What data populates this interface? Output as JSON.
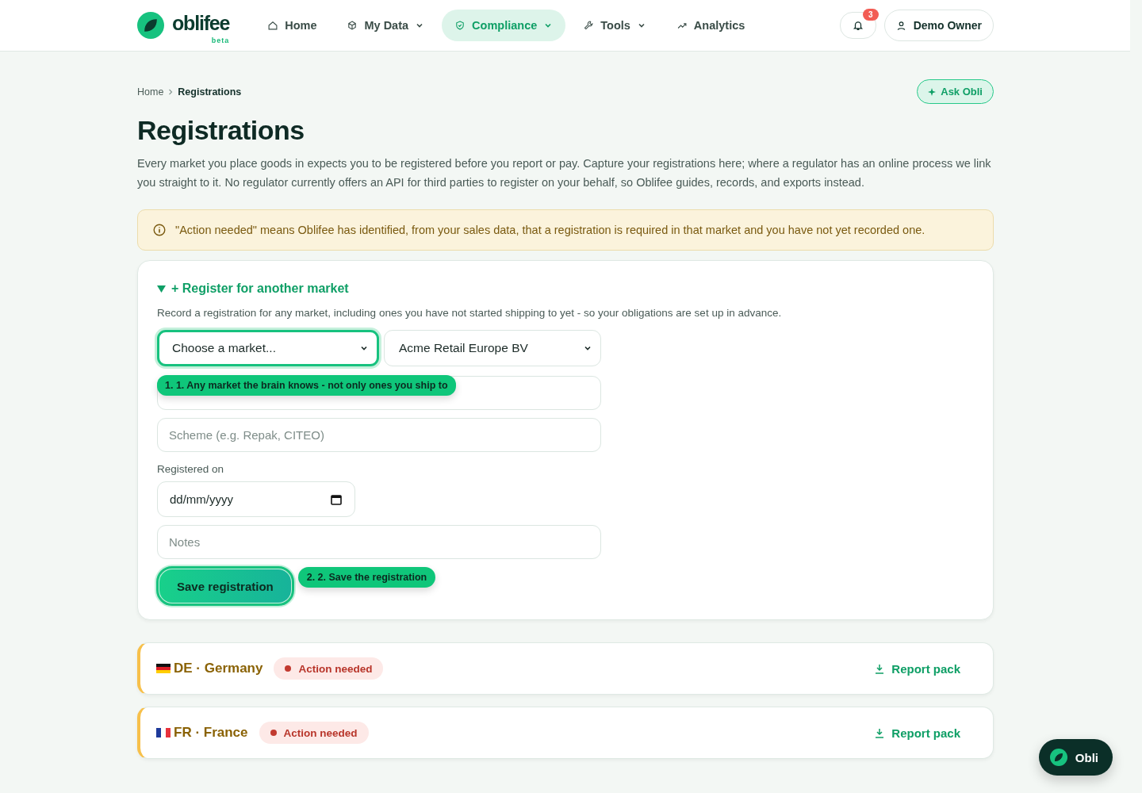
{
  "header": {
    "logo": "oblifee",
    "logo_tag": "beta",
    "nav": [
      {
        "label": "Home",
        "dropdown": false,
        "selected": false
      },
      {
        "label": "My Data",
        "dropdown": true,
        "selected": false
      },
      {
        "label": "Compliance",
        "dropdown": true,
        "selected": true
      },
      {
        "label": "Tools",
        "dropdown": true,
        "selected": false
      },
      {
        "label": "Analytics",
        "dropdown": false,
        "selected": false
      }
    ],
    "notifications": "3",
    "user": "Demo Owner"
  },
  "breadcrumb": [
    {
      "label": "Home",
      "selected": false
    },
    {
      "label": "Registrations",
      "selected": true
    }
  ],
  "ask_button": "Ask Obli",
  "title": "Registrations",
  "intro": "Every market you place goods in expects you to be registered before you report or pay. Capture your registrations here; where a regulator has an online process we link you straight to it. No regulator currently offers an API for third parties to register on your behalf, so Oblifee guides, records, and exports instead.",
  "notice": "\"Action needed\" means Oblifee has identified, from your sales data, that a registration is required in that market and you have not yet recorded one.",
  "form": {
    "title": "+ Register for another market",
    "expanded": true,
    "description": "Record a registration for any market, including ones you have not started shipping to yet - so your obligations are set up in advance.",
    "market_select": {
      "value": "Choose a market...",
      "highlighted": true,
      "tip": "1. 1. Any market the brain knows - not only ones you ship to"
    },
    "company_select": {
      "value": "Acme Retail Europe BV",
      "highlighted": false
    },
    "scheme": {
      "placeholder": "Scheme (e.g. Repak, CITEO)"
    },
    "date_label": "Registered on",
    "date": {
      "placeholder": "dd/mm/yyyy"
    },
    "notes": {
      "placeholder": "Notes"
    },
    "save_button": {
      "label": "Save registration",
      "highlighted": true,
      "tip": "2. 2. Save the registration"
    }
  },
  "markets": [
    {
      "label": "DE · Germany",
      "status": "Action needed",
      "action": "Report pack"
    },
    {
      "label": "FR · France",
      "status": "Action needed",
      "action": "Report pack"
    }
  ],
  "assistant_button": "Obli"
}
